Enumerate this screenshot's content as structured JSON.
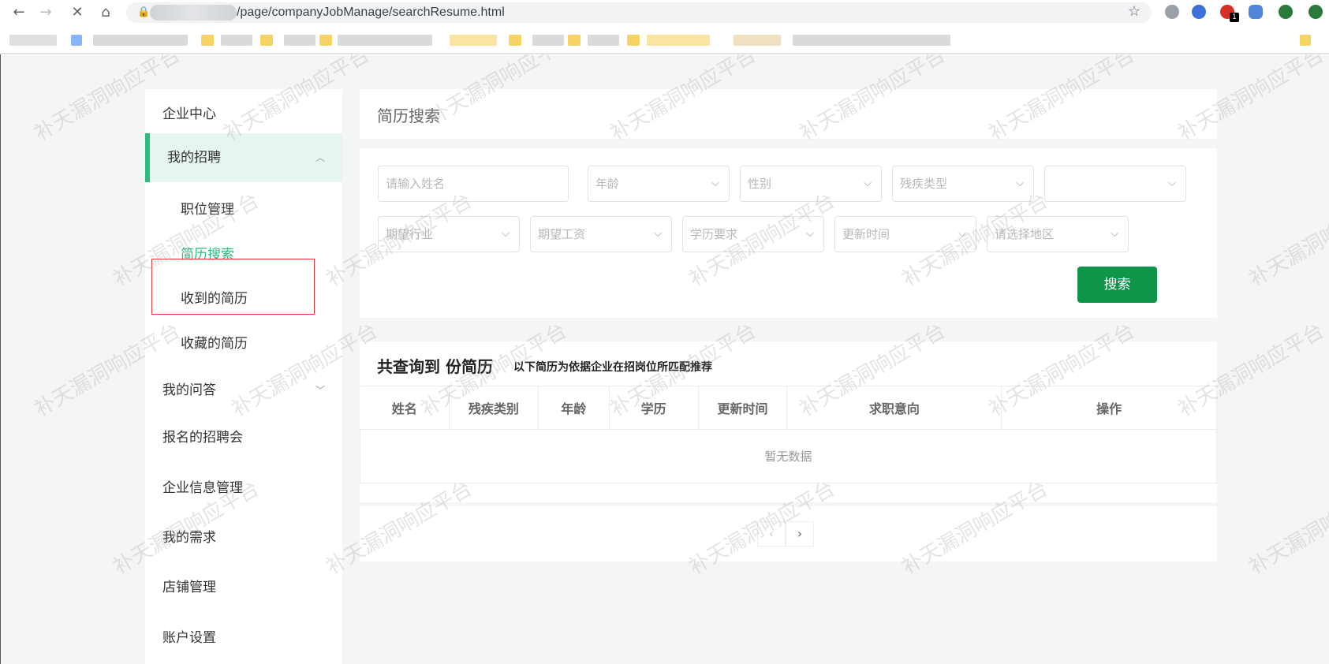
{
  "browser": {
    "url": "/page/companyJobManage/searchResume.html",
    "ext_badge": "1",
    "ext_colors": [
      "#9aa0a6",
      "#3c6fd8",
      "#d93025",
      "#4f86d9",
      "#2a7a3b"
    ]
  },
  "sidebar": {
    "items": [
      {
        "label": "企业中心"
      },
      {
        "label": "我的招聘"
      },
      {
        "label": "我的问答"
      },
      {
        "label": "报名的招聘会"
      },
      {
        "label": "企业信息管理"
      },
      {
        "label": "我的需求"
      },
      {
        "label": "店铺管理"
      },
      {
        "label": "账户设置"
      }
    ],
    "sub_items": [
      {
        "label": "职位管理"
      },
      {
        "label": "简历搜索"
      },
      {
        "label": "收到的简历"
      },
      {
        "label": "收藏的简历"
      }
    ],
    "active_color": "#2dbb7e"
  },
  "main": {
    "title": "简历搜索",
    "filters": {
      "name_placeholder": "请输入姓名",
      "age": "年龄",
      "gender": "性别",
      "disability_type": "残疾类型",
      "extra": "",
      "industry": "期望行业",
      "salary": "期望工资",
      "education": "学历要求",
      "update_time": "更新时间",
      "region": "请选择地区"
    },
    "search_label": "搜索",
    "search_color": "#0f944a",
    "result_title": "共查询到 份简历",
    "result_sub": "以下简历为依据企业在招岗位所匹配推荐",
    "table": {
      "headers": [
        "姓名",
        "残疾类别",
        "年龄",
        "学历",
        "更新时间",
        "求职意向",
        "操作"
      ],
      "empty_text": "暂无数据"
    },
    "pager": {
      "prev": "‹",
      "next": "›"
    }
  },
  "watermark": "补天漏洞响应平台"
}
